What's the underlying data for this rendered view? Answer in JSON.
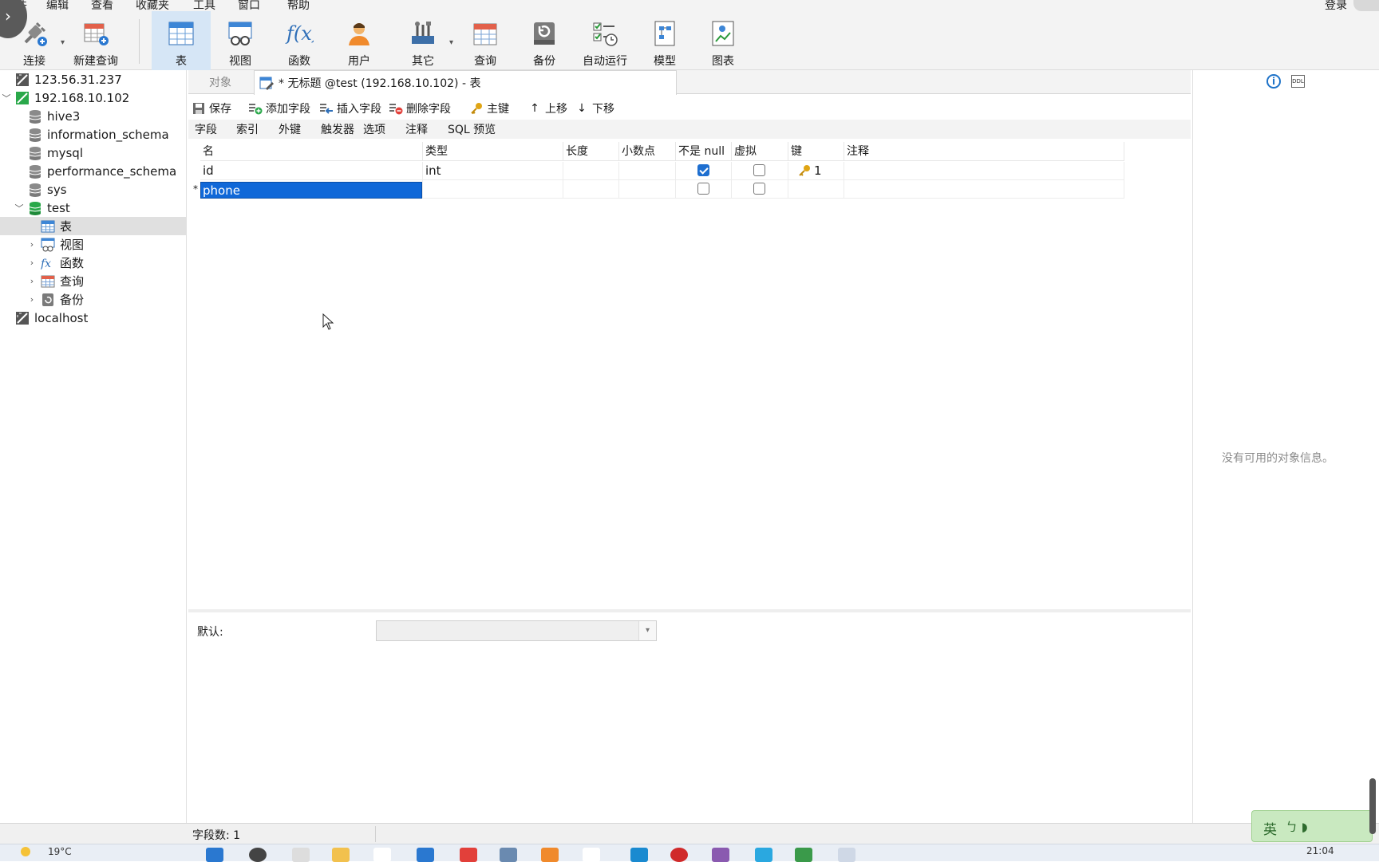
{
  "menubar": {
    "items": [
      "文件",
      "编辑",
      "查看",
      "收藏夹",
      "工具",
      "窗口",
      "帮助"
    ],
    "login": "登录"
  },
  "ribbon": {
    "buttons": [
      {
        "label": "连接",
        "icon": "plug-icon"
      },
      {
        "label": "新建查询",
        "icon": "new-query-icon"
      },
      {
        "label": "表",
        "icon": "table-icon",
        "active": true
      },
      {
        "label": "视图",
        "icon": "view-icon"
      },
      {
        "label": "函数",
        "icon": "function-icon"
      },
      {
        "label": "用户",
        "icon": "user-icon"
      },
      {
        "label": "其它",
        "icon": "tools-icon"
      },
      {
        "label": "查询",
        "icon": "query-icon"
      },
      {
        "label": "备份",
        "icon": "backup-icon"
      },
      {
        "label": "自动运行",
        "icon": "autorun-icon"
      },
      {
        "label": "模型",
        "icon": "model-icon"
      },
      {
        "label": "图表",
        "icon": "chart-icon"
      }
    ]
  },
  "tree": {
    "items": [
      {
        "label": "123.56.31.237",
        "icon": "server-disconnected-icon"
      },
      {
        "label": "192.168.10.102",
        "icon": "server-connected-icon",
        "expanded": true
      },
      {
        "label": "hive3",
        "icon": "database-icon"
      },
      {
        "label": "information_schema",
        "icon": "database-icon"
      },
      {
        "label": "mysql",
        "icon": "database-icon"
      },
      {
        "label": "performance_schema",
        "icon": "database-icon"
      },
      {
        "label": "sys",
        "icon": "database-icon"
      },
      {
        "label": "test",
        "icon": "database-open-icon",
        "expanded": true
      },
      {
        "label": "表",
        "icon": "table-icon",
        "selected": true
      },
      {
        "label": "视图",
        "icon": "view-icon"
      },
      {
        "label": "函数",
        "icon": "function-icon"
      },
      {
        "label": "查询",
        "icon": "query-icon"
      },
      {
        "label": "备份",
        "icon": "backup-icon"
      },
      {
        "label": "localhost",
        "icon": "server-disconnected-icon"
      }
    ]
  },
  "tabs": {
    "objects": "对象",
    "table_tab": "* 无标题 @test (192.168.10.102) - 表"
  },
  "editor_toolbar": {
    "save": "保存",
    "add_field": "添加字段",
    "insert_field": "插入字段",
    "delete_field": "删除字段",
    "primary_key": "主键",
    "move_up": "上移",
    "move_down": "下移"
  },
  "subtabs": [
    "字段",
    "索引",
    "外键",
    "触发器",
    "选项",
    "注释",
    "SQL 预览"
  ],
  "grid": {
    "headers": [
      "名",
      "类型",
      "长度",
      "小数点",
      "不是 null",
      "虚拟",
      "键",
      "注释"
    ],
    "rows": [
      {
        "name": "id",
        "type": "int",
        "not_null": true,
        "virtual": false,
        "key": "1"
      },
      {
        "name": "phone",
        "type": "",
        "not_null": false,
        "virtual": false,
        "key": "",
        "editing": true,
        "marker": "*"
      }
    ]
  },
  "props": {
    "default_label": "默认:"
  },
  "info_pane": {
    "message": "没有可用的对象信息。",
    "ddl_label": "DDL"
  },
  "statusbar": {
    "field_count": "字段数: 1"
  },
  "ime": {
    "lang": "英",
    "extra": "ㄅ ◗"
  },
  "taskbar": {
    "weather": "19°C",
    "clock": "21:04"
  },
  "colors": {
    "accent": "#1068d8",
    "active_tab": "#d6e6f6",
    "key_gold": "#e0a514"
  }
}
